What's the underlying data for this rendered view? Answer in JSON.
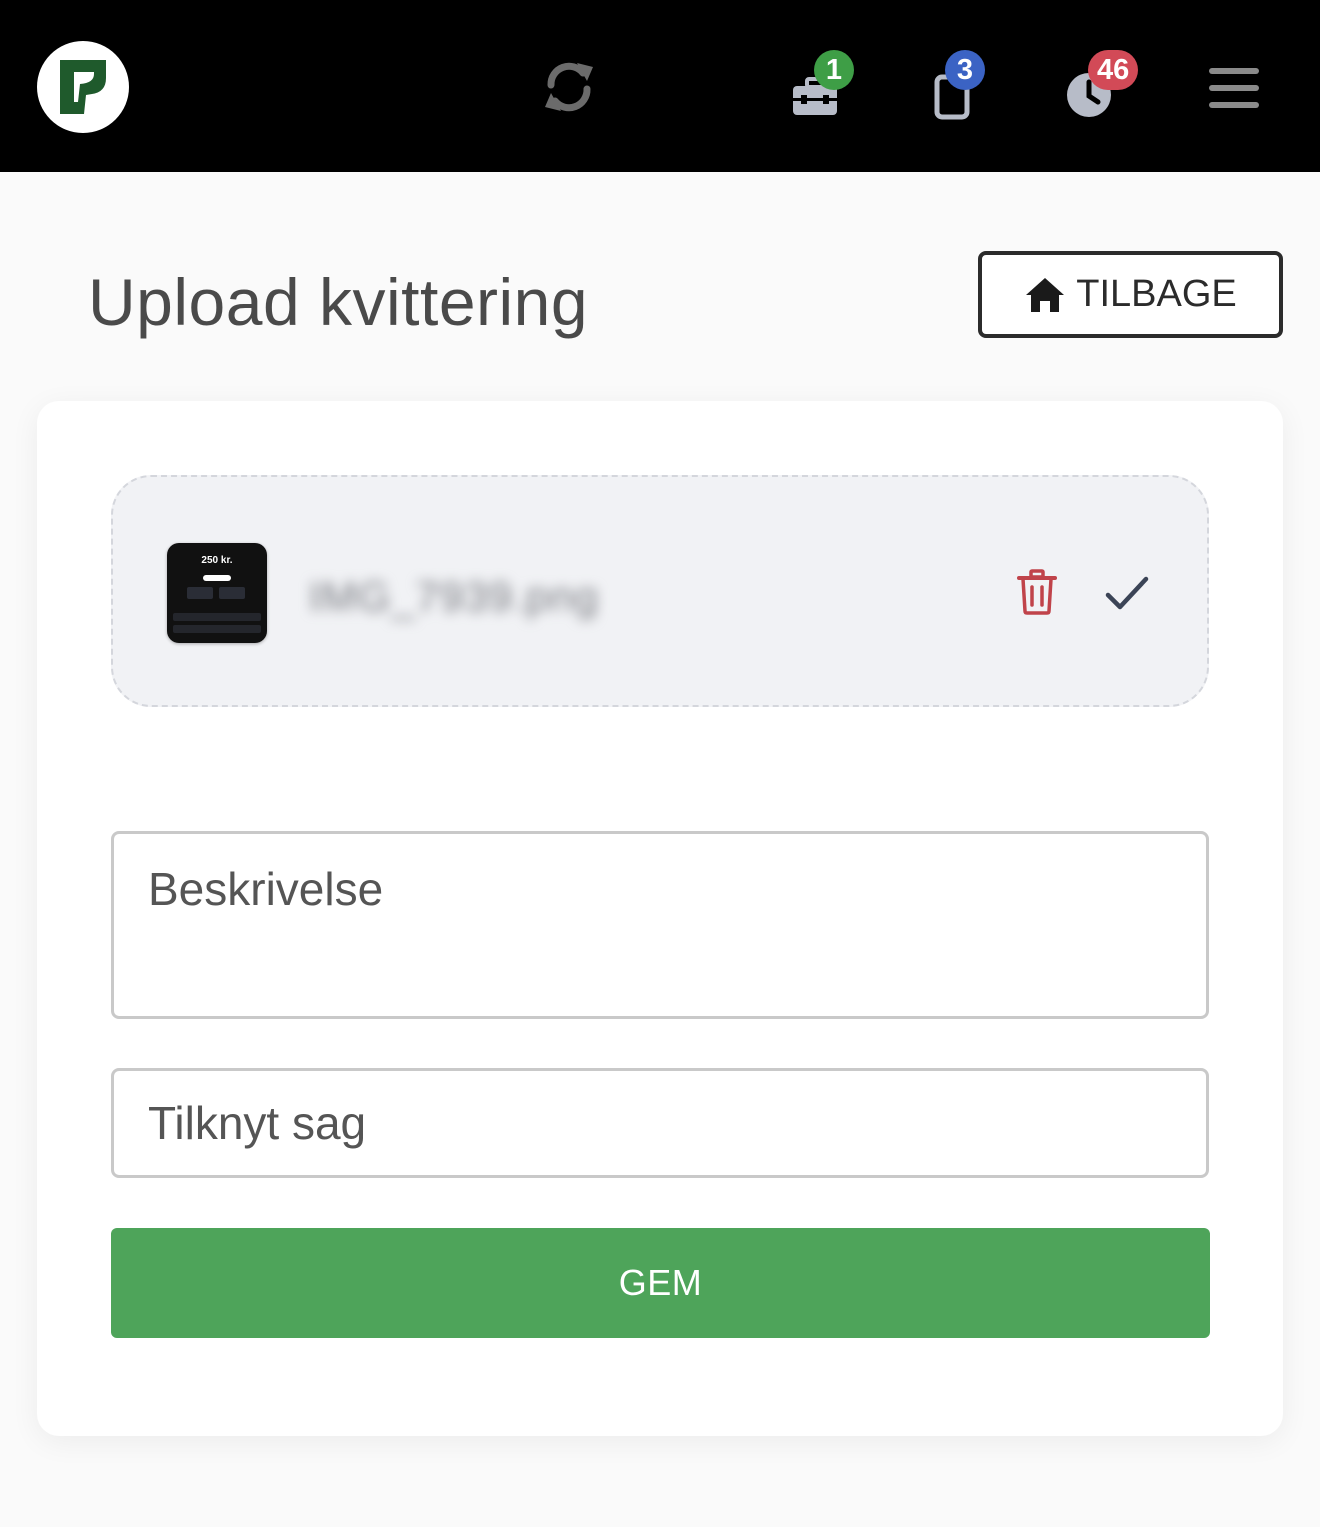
{
  "header": {
    "logo_alt": "logo",
    "icons": [
      {
        "name": "sync-icon"
      },
      {
        "name": "toolbox-icon",
        "badge": "1",
        "badge_color": "#3e9e46"
      },
      {
        "name": "tablet-icon",
        "badge": "3",
        "badge_color": "#3b63c4"
      },
      {
        "name": "clock-icon",
        "badge": "46",
        "badge_color": "#d24a57"
      },
      {
        "name": "hamburger-menu-icon"
      }
    ]
  },
  "page": {
    "title": "Upload kvittering",
    "back_label": "TILBAGE"
  },
  "upload": {
    "thumbnail_amount": "250 kr.",
    "filename": "IMG_7939.png"
  },
  "form": {
    "description_placeholder": "Beskrivelse",
    "case_placeholder": "Tilknyt sag",
    "save_label": "GEM"
  },
  "colors": {
    "brand_green": "#1f5a2c",
    "save_button": "#4ea45a",
    "delete_icon": "#c0434a",
    "check_icon": "#3b4456"
  }
}
